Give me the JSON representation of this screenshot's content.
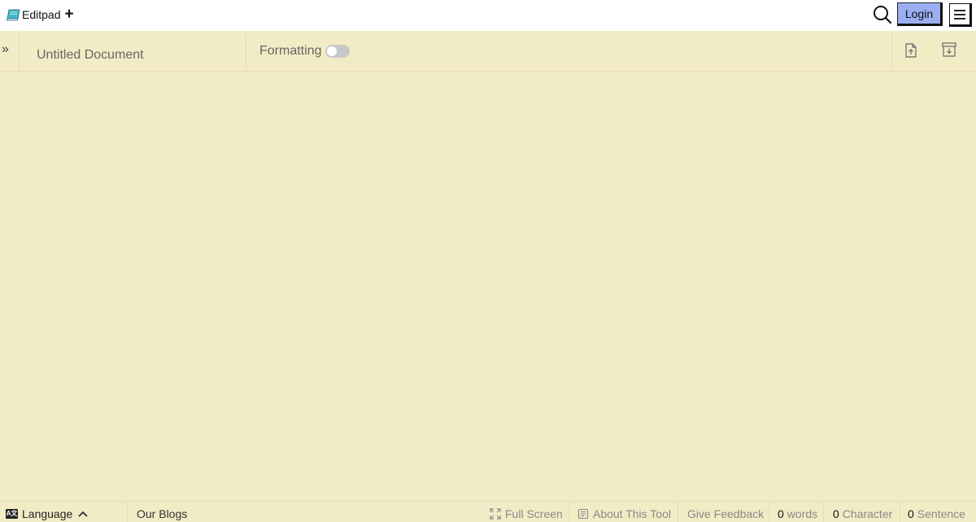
{
  "header": {
    "brand_name": "Editpad",
    "new_doc_symbol": "+",
    "login_label": "Login",
    "icons": {
      "logo": "editpad-logo-icon",
      "search": "search-icon",
      "menu": "hamburger-menu-icon"
    },
    "colors": {
      "login_bg": "#9aaef0",
      "logo_teal": "#3fb6c6"
    }
  },
  "toolbar": {
    "sidebar_toggle": "»",
    "doc_title": "Untitled Document",
    "formatting_label": "Formatting",
    "formatting_enabled": false,
    "icons": {
      "upload": "upload-file-icon",
      "download": "download-file-icon"
    }
  },
  "editor": {
    "content": ""
  },
  "footer": {
    "language_icon_text": "A文",
    "language_label": "Language",
    "blogs_label": "Our Blogs",
    "full_screen_label": "Full Screen",
    "about_label": "About This Tool",
    "feedback_label": "Give Feedback",
    "words_count": "0",
    "words_label": "words",
    "characters_count": "0",
    "characters_label": "Character",
    "sentences_count": "0",
    "sentences_label": "Sentence"
  },
  "theme": {
    "page_bg": "#f2ecc6",
    "header_bg": "#ffffff",
    "divider": "#e3dcb3"
  }
}
